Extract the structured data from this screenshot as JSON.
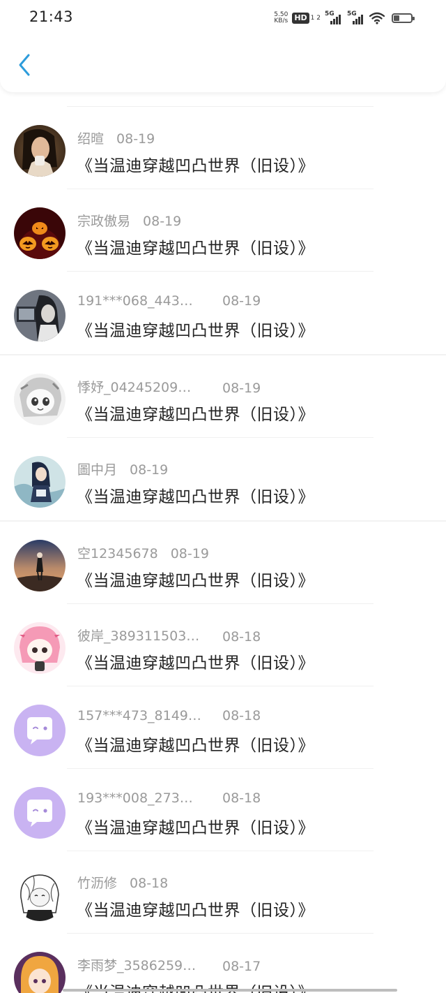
{
  "status_bar": {
    "time": "21:43",
    "net_speed_value": "5.50",
    "net_speed_unit": "KB/s",
    "hd_label": "HD",
    "sim_index": "1 2",
    "signal1": "5G",
    "signal2": "5G"
  },
  "header": {
    "back_icon": "chevron-left-icon"
  },
  "items": [
    {
      "name": "绍暄",
      "date": "08-19",
      "title": "《当温迪穿越凹凸世界（旧设）》",
      "avatar": "photo-woman"
    },
    {
      "name": "宗政傲易",
      "date": "08-19",
      "title": "《当温迪穿越凹凸世界（旧设）》",
      "avatar": "pumpkins"
    },
    {
      "name": "191***068_443…",
      "date": "08-19",
      "title": "《当温迪穿越凹凸世界（旧设）》",
      "avatar": "anime-dark"
    },
    {
      "name": "悸妤_04245209…",
      "date": "08-19",
      "title": "《当温迪穿越凹凸世界（旧设）》",
      "avatar": "anime-white"
    },
    {
      "name": "圖中月",
      "date": "08-19",
      "title": "《当温迪穿越凹凸世界（旧设）》",
      "avatar": "anime-blue"
    },
    {
      "name": "空12345678",
      "date": "08-19",
      "title": "《当温迪穿越凹凸世界（旧设）》",
      "avatar": "sunset"
    },
    {
      "name": "彼岸_389311503…",
      "date": "08-18",
      "title": "《当温迪穿越凹凸世界（旧设）》",
      "avatar": "anime-pink"
    },
    {
      "name": "157***473_8149…",
      "date": "08-18",
      "title": "《当温迪穿越凹凸世界（旧设）》",
      "avatar": "default-purple"
    },
    {
      "name": "193***008_273…",
      "date": "08-18",
      "title": "《当温迪穿越凹凸世界（旧设）》",
      "avatar": "default-purple"
    },
    {
      "name": "竹沥修",
      "date": "08-18",
      "title": "《当温迪穿越凹凸世界（旧设）》",
      "avatar": "sketch"
    },
    {
      "name": "李雨梦_3586259…",
      "date": "08-17",
      "title": "《当温迪穿越凹凸世界（旧设）》",
      "avatar": "anime-orange"
    }
  ],
  "colors": {
    "accent": "#2d9cdb",
    "name_gray": "#9a9a9a",
    "title": "#222222",
    "default_avatar": "#c9b3f2"
  }
}
